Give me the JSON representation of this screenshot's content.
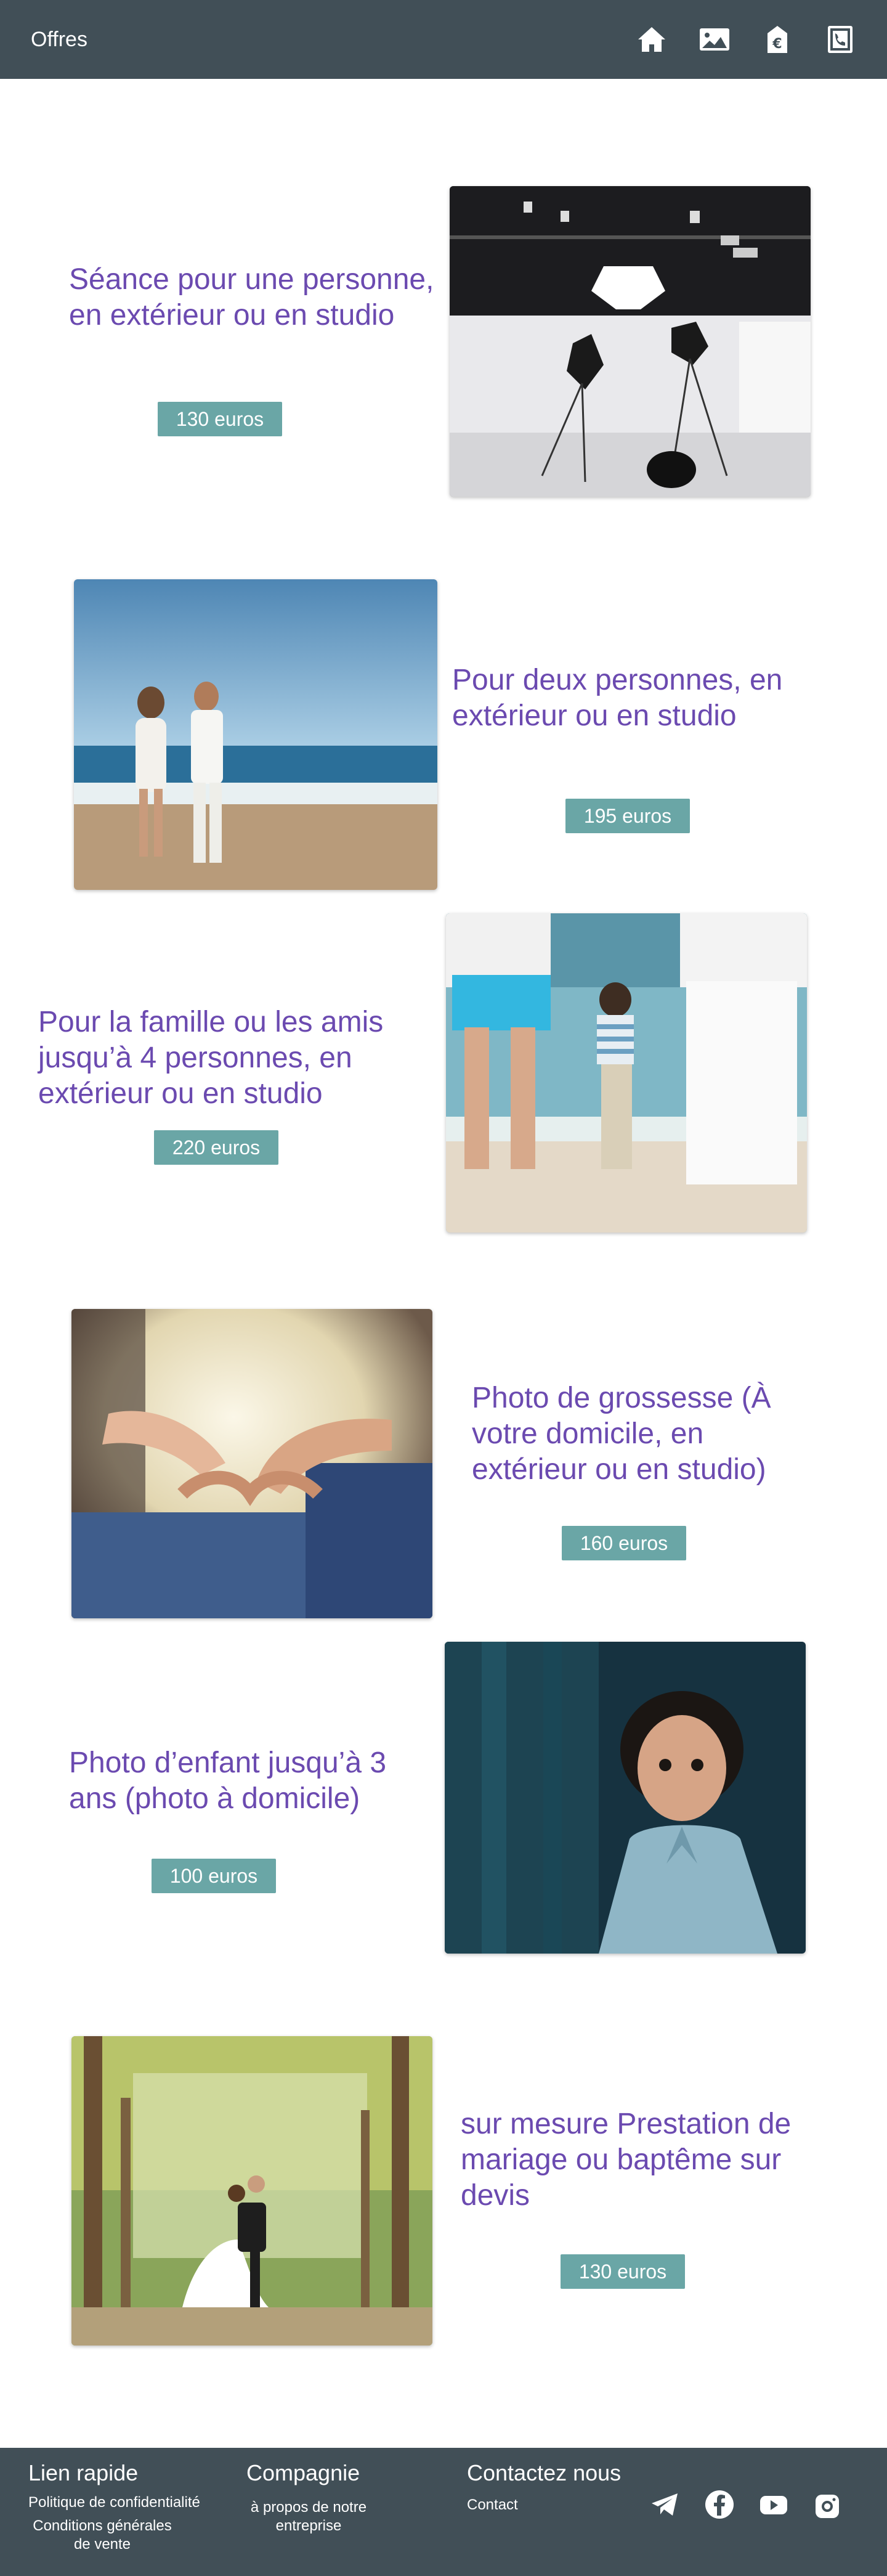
{
  "header": {
    "title": "Offres",
    "icons": [
      "home-icon",
      "gallery-icon",
      "euro-icon",
      "phone-book-icon"
    ]
  },
  "offers": [
    {
      "title": "Séance pour une personne, en extérieur ou en studio",
      "price": "130 euros",
      "image": "studio-lighting"
    },
    {
      "title": "Pour deux personnes, en extérieur ou en studio",
      "price": "195 euros",
      "image": "couple-beach"
    },
    {
      "title": "Pour la famille ou les amis jusqu’à 4 personnes, en extérieur ou en studio",
      "price": "220 euros",
      "image": "family-beach"
    },
    {
      "title": "Photo de grossesse (À votre domicile, en extérieur ou en studio)",
      "price": "160 euros",
      "image": "pregnancy-heart-hands"
    },
    {
      "title": "Photo d’enfant jusqu’à 3 ans (photo à domicile)",
      "price": "100 euros",
      "image": "child-portrait"
    },
    {
      "title": "sur mesure Prestation de mariage ou baptême sur devis",
      "price": "130 euros",
      "image": "wedding-couple-forest"
    }
  ],
  "footer": {
    "quick_links": {
      "title": "Lien rapide",
      "privacy": "Politique de confidentialité",
      "terms": "Conditions générales de vente"
    },
    "company": {
      "title": "Compagnie",
      "about": "à propos de notre entreprise"
    },
    "contact": {
      "title": "Contactez nous",
      "contact": "Contact"
    },
    "social_icons": [
      "telegram-icon",
      "facebook-icon",
      "youtube-icon",
      "instagram-icon"
    ]
  }
}
